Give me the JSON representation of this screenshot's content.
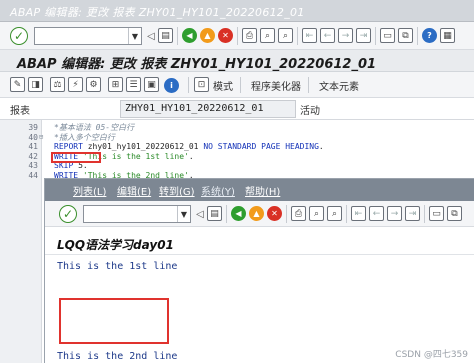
{
  "window": {
    "title": "ABAP 编辑器: 更改 报表 ZHY01_HY101_20220612_01",
    "header_title": "ABAP 编辑器: 更改 报表 ZHY01_HY101_20220612_01"
  },
  "toolbar": {
    "command_field_value": "",
    "icons": [
      "check-icon",
      "save-icon",
      "back-icon",
      "exit-icon",
      "cancel-icon",
      "print-icon",
      "find-icon",
      "find-next-icon",
      "first-page-icon",
      "prev-page-icon",
      "next-page-icon",
      "last-page-icon",
      "new-session-icon",
      "shortcut-icon",
      "help-icon",
      "customize-icon"
    ]
  },
  "app_toolbar": {
    "buttons": [
      {
        "icon": "toggle-display-change-icon"
      },
      {
        "icon": "other-object-icon"
      },
      {
        "icon": "check-syntax-icon"
      },
      {
        "icon": "activate-icon"
      },
      {
        "icon": "test-icon"
      },
      {
        "icon": "where-used-icon"
      },
      {
        "icon": "object-list-icon"
      },
      {
        "icon": "navigation-window-icon"
      },
      {
        "icon": "info-icon"
      }
    ],
    "text_buttons": [
      "模式",
      "程序美化器",
      "文本元素"
    ]
  },
  "field_row": {
    "label": "报表",
    "value": "ZHY01_HY101_20220612_01",
    "status": "活动"
  },
  "editor": {
    "lines": [
      {
        "num": "39",
        "fold": "",
        "parts": [
          {
            "t": "*基本语法 05-空白行",
            "c": "cmt"
          }
        ]
      },
      {
        "num": "40",
        "fold": "⊟",
        "parts": [
          {
            "t": "*插入多个空白行",
            "c": "cmt"
          }
        ]
      },
      {
        "num": "41",
        "fold": "",
        "parts": [
          {
            "t": "REPORT",
            "c": "kw"
          },
          {
            "t": " zhy01_hy101_20220612_01 ",
            "c": ""
          },
          {
            "t": "NO STANDARD PAGE HEADING",
            "c": "kw"
          },
          {
            "t": ".",
            "c": ""
          }
        ]
      },
      {
        "num": "42",
        "fold": "",
        "parts": [
          {
            "t": "WRITE",
            "c": "kw"
          },
          {
            "t": " ",
            "c": ""
          },
          {
            "t": "'This is the 1st line'",
            "c": "str"
          },
          {
            "t": ".",
            "c": ""
          }
        ]
      },
      {
        "num": "43",
        "fold": "",
        "parts": [
          {
            "t": "SKIP",
            "c": "kw"
          },
          {
            "t": " 5.",
            "c": ""
          }
        ]
      },
      {
        "num": "44",
        "fold": "",
        "parts": [
          {
            "t": "WRITE",
            "c": "kw"
          },
          {
            "t": " ",
            "c": ""
          },
          {
            "t": "'This is the 2nd line'",
            "c": "str"
          },
          {
            "t": ".",
            "c": ""
          }
        ]
      }
    ]
  },
  "popup": {
    "menu": [
      {
        "label": "列表(L)"
      },
      {
        "label": "编辑(E)"
      },
      {
        "label": "转到(G)"
      },
      {
        "label": "系统(Y)"
      },
      {
        "label": "帮助(H)"
      }
    ],
    "command_field_value": "",
    "title": "LQQ语法学习day01",
    "output_lines": [
      "This is the 1st line",
      "This is the 2nd line"
    ]
  },
  "watermark": "CSDN @四七359",
  "colors": {
    "menubar_bg": "#7d8793",
    "highlight_red": "#e0332e",
    "keyword_blue": "#1533b8",
    "string_green": "#2a8a28",
    "comment_gray": "#7b8a9a",
    "output_text": "#1e3a8a"
  }
}
